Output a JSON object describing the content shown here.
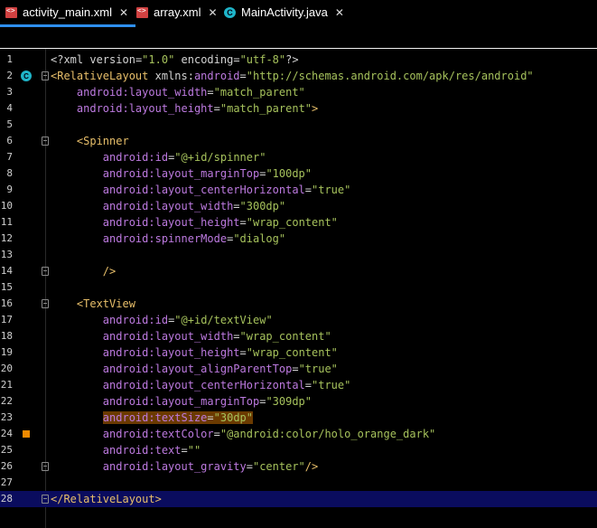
{
  "tabs": [
    {
      "label": "activity_main.xml",
      "icon": "xml-file-icon",
      "active": true
    },
    {
      "label": "array.xml",
      "icon": "xml-file-icon",
      "active": false
    },
    {
      "label": "MainActivity.java",
      "icon": "class-icon",
      "active": false
    }
  ],
  "close_glyph": "✕",
  "colors": {
    "tag": "#e8bf6a",
    "attribute": "#bd7ae0",
    "value": "#a6c25c",
    "current_line": "#0a0c5e",
    "active_tab_underline": "#2e8ff0"
  },
  "editor": {
    "lines": [
      {
        "n": "1",
        "indent": "",
        "parts": [
          {
            "t": "<?",
            "c": "plain"
          },
          {
            "t": "xml version",
            "c": "plain"
          },
          {
            "t": "=",
            "c": "plain"
          },
          {
            "t": "\"1.0\"",
            "c": "val"
          },
          {
            "t": " encoding",
            "c": "plain"
          },
          {
            "t": "=",
            "c": "plain"
          },
          {
            "t": "\"utf-8\"",
            "c": "val"
          },
          {
            "t": "?>",
            "c": "plain"
          }
        ]
      },
      {
        "n": "2",
        "indent": "",
        "parts": [
          {
            "t": "<RelativeLayout ",
            "c": "tag"
          },
          {
            "t": "xmlns:",
            "c": "plain"
          },
          {
            "t": "android",
            "c": "ns"
          },
          {
            "t": "=",
            "c": "plain"
          },
          {
            "t": "\"http://schemas.android.com/apk/res/android\"",
            "c": "val"
          }
        ]
      },
      {
        "n": "3",
        "indent": "    ",
        "parts": [
          {
            "t": "android",
            "c": "ns"
          },
          {
            "t": ":layout_width",
            "c": "attr"
          },
          {
            "t": "=",
            "c": "plain"
          },
          {
            "t": "\"match_parent\"",
            "c": "val"
          }
        ]
      },
      {
        "n": "4",
        "indent": "    ",
        "parts": [
          {
            "t": "android",
            "c": "ns"
          },
          {
            "t": ":layout_height",
            "c": "attr"
          },
          {
            "t": "=",
            "c": "plain"
          },
          {
            "t": "\"match_parent\"",
            "c": "val"
          },
          {
            "t": ">",
            "c": "tag"
          }
        ]
      },
      {
        "n": "5",
        "indent": "",
        "parts": []
      },
      {
        "n": "6",
        "indent": "    ",
        "parts": [
          {
            "t": "<Spinner",
            "c": "tag"
          }
        ]
      },
      {
        "n": "7",
        "indent": "        ",
        "parts": [
          {
            "t": "android",
            "c": "ns"
          },
          {
            "t": ":id",
            "c": "attr"
          },
          {
            "t": "=",
            "c": "plain"
          },
          {
            "t": "\"@+id/spinner\"",
            "c": "val"
          }
        ]
      },
      {
        "n": "8",
        "indent": "        ",
        "parts": [
          {
            "t": "android",
            "c": "ns"
          },
          {
            "t": ":layout_marginTop",
            "c": "attr"
          },
          {
            "t": "=",
            "c": "plain"
          },
          {
            "t": "\"100dp\"",
            "c": "val"
          }
        ]
      },
      {
        "n": "9",
        "indent": "        ",
        "parts": [
          {
            "t": "android",
            "c": "ns"
          },
          {
            "t": ":layout_centerHorizontal",
            "c": "attr"
          },
          {
            "t": "=",
            "c": "plain"
          },
          {
            "t": "\"true\"",
            "c": "val"
          }
        ]
      },
      {
        "n": "10",
        "indent": "        ",
        "parts": [
          {
            "t": "android",
            "c": "ns"
          },
          {
            "t": ":layout_width",
            "c": "attr"
          },
          {
            "t": "=",
            "c": "plain"
          },
          {
            "t": "\"300dp\"",
            "c": "val"
          }
        ]
      },
      {
        "n": "11",
        "indent": "        ",
        "parts": [
          {
            "t": "android",
            "c": "ns"
          },
          {
            "t": ":layout_height",
            "c": "attr"
          },
          {
            "t": "=",
            "c": "plain"
          },
          {
            "t": "\"wrap_content\"",
            "c": "val"
          }
        ]
      },
      {
        "n": "12",
        "indent": "        ",
        "parts": [
          {
            "t": "android",
            "c": "ns"
          },
          {
            "t": ":spinnerMode",
            "c": "attr"
          },
          {
            "t": "=",
            "c": "plain"
          },
          {
            "t": "\"dialog\"",
            "c": "val"
          }
        ]
      },
      {
        "n": "13",
        "indent": "",
        "parts": []
      },
      {
        "n": "14",
        "indent": "        ",
        "parts": [
          {
            "t": "/>",
            "c": "tag"
          }
        ]
      },
      {
        "n": "15",
        "indent": "",
        "parts": []
      },
      {
        "n": "16",
        "indent": "    ",
        "parts": [
          {
            "t": "<TextView",
            "c": "tag"
          }
        ]
      },
      {
        "n": "17",
        "indent": "        ",
        "parts": [
          {
            "t": "android",
            "c": "ns"
          },
          {
            "t": ":id",
            "c": "attr"
          },
          {
            "t": "=",
            "c": "plain"
          },
          {
            "t": "\"@+id/textView\"",
            "c": "val"
          }
        ]
      },
      {
        "n": "18",
        "indent": "        ",
        "parts": [
          {
            "t": "android",
            "c": "ns"
          },
          {
            "t": ":layout_width",
            "c": "attr"
          },
          {
            "t": "=",
            "c": "plain"
          },
          {
            "t": "\"wrap_content\"",
            "c": "val"
          }
        ]
      },
      {
        "n": "19",
        "indent": "        ",
        "parts": [
          {
            "t": "android",
            "c": "ns"
          },
          {
            "t": ":layout_height",
            "c": "attr"
          },
          {
            "t": "=",
            "c": "plain"
          },
          {
            "t": "\"wrap_content\"",
            "c": "val"
          }
        ]
      },
      {
        "n": "20",
        "indent": "        ",
        "parts": [
          {
            "t": "android",
            "c": "ns"
          },
          {
            "t": ":layout_alignParentTop",
            "c": "attr"
          },
          {
            "t": "=",
            "c": "plain"
          },
          {
            "t": "\"true\"",
            "c": "val"
          }
        ]
      },
      {
        "n": "21",
        "indent": "        ",
        "parts": [
          {
            "t": "android",
            "c": "ns"
          },
          {
            "t": ":layout_centerHorizontal",
            "c": "attr"
          },
          {
            "t": "=",
            "c": "plain"
          },
          {
            "t": "\"true\"",
            "c": "val"
          }
        ]
      },
      {
        "n": "22",
        "indent": "        ",
        "parts": [
          {
            "t": "android",
            "c": "ns"
          },
          {
            "t": ":layout_marginTop",
            "c": "attr"
          },
          {
            "t": "=",
            "c": "plain"
          },
          {
            "t": "\"309dp\"",
            "c": "val"
          }
        ]
      },
      {
        "n": "23",
        "indent": "        ",
        "highlight": true,
        "parts": [
          {
            "t": "android",
            "c": "ns"
          },
          {
            "t": ":textSize",
            "c": "attr"
          },
          {
            "t": "=",
            "c": "plain"
          },
          {
            "t": "\"30dp\"",
            "c": "val"
          }
        ]
      },
      {
        "n": "24",
        "indent": "        ",
        "parts": [
          {
            "t": "android",
            "c": "ns"
          },
          {
            "t": ":textColor",
            "c": "attr"
          },
          {
            "t": "=",
            "c": "plain"
          },
          {
            "t": "\"@android:color/holo_orange_dark\"",
            "c": "val"
          }
        ]
      },
      {
        "n": "25",
        "indent": "        ",
        "parts": [
          {
            "t": "android",
            "c": "ns"
          },
          {
            "t": ":text",
            "c": "attr"
          },
          {
            "t": "=",
            "c": "plain"
          },
          {
            "t": "\"\"",
            "c": "val"
          }
        ]
      },
      {
        "n": "26",
        "indent": "        ",
        "parts": [
          {
            "t": "android",
            "c": "ns"
          },
          {
            "t": ":layout_gravity",
            "c": "attr"
          },
          {
            "t": "=",
            "c": "plain"
          },
          {
            "t": "\"center\"",
            "c": "val"
          },
          {
            "t": "/>",
            "c": "tag"
          }
        ]
      },
      {
        "n": "27",
        "indent": "",
        "parts": []
      },
      {
        "n": "28",
        "indent": "",
        "current": true,
        "parts": [
          {
            "t": "</RelativeLayout>",
            "c": "tag"
          }
        ]
      }
    ],
    "gutter_marks": {
      "2": "class-marker-icon",
      "24": "color-swatch-icon"
    },
    "fold_lines": [
      "2",
      "6",
      "14",
      "16",
      "26",
      "28"
    ]
  }
}
